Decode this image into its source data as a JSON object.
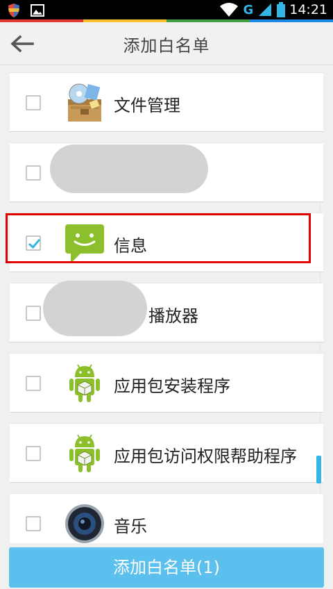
{
  "status_bar": {
    "network": "G",
    "time": "14:21"
  },
  "header": {
    "title": "添加白名单"
  },
  "apps": [
    {
      "label": "文件管理",
      "checked": false,
      "icon": "file-manager-icon"
    },
    {
      "label": "",
      "checked": false,
      "icon": "obscured-app-icon"
    },
    {
      "label": "信息",
      "checked": true,
      "icon": "messaging-icon"
    },
    {
      "label": "播放器",
      "checked": false,
      "icon": "obscured-app-icon"
    },
    {
      "label": "应用包安装程序",
      "checked": false,
      "icon": "android-package-icon"
    },
    {
      "label": "应用包访问权限帮助程序",
      "checked": false,
      "icon": "android-package-icon"
    },
    {
      "label": "音乐",
      "checked": false,
      "icon": "music-speaker-icon"
    }
  ],
  "footer": {
    "button_label": "添加白名单(1)"
  },
  "colors": {
    "accent": "#33b5e5",
    "button": "#5cc0ee",
    "highlight": "#e00000"
  }
}
